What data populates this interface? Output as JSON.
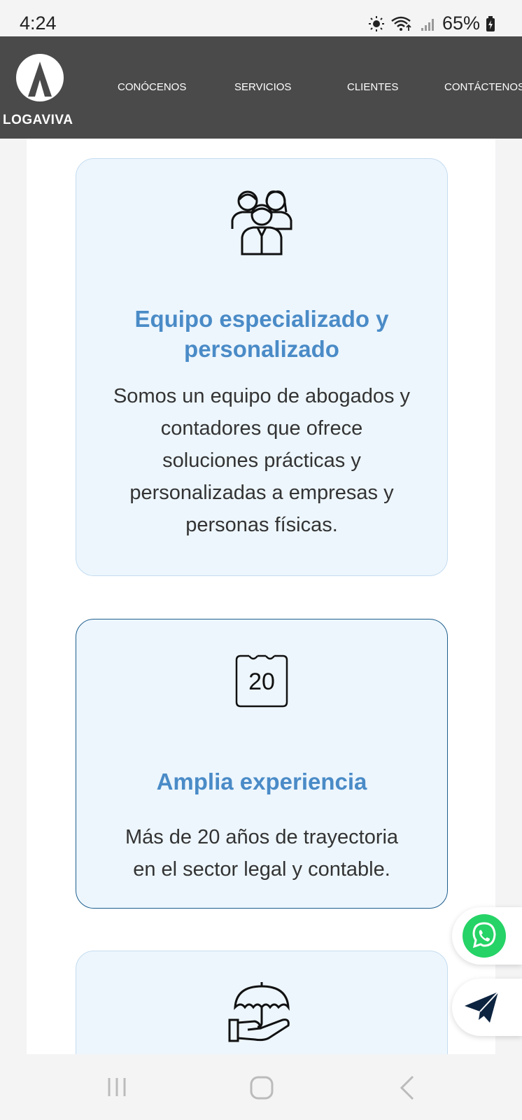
{
  "status": {
    "time": "4:24",
    "battery": "65%"
  },
  "brand": {
    "logo_text": "LOGAVIVA"
  },
  "nav": {
    "items": [
      "CONÓCENOS",
      "SERVICIOS",
      "CLIENTES",
      "CONTÁCTENOS"
    ]
  },
  "cards": [
    {
      "icon": "team-icon",
      "title_line1": "Equipo especializado y",
      "title_line2": "personalizado",
      "text_lines": [
        "Somos un equipo de abogados y",
        "contadores que ofrece",
        "soluciones prácticas y",
        "personalizadas a empresas y",
        "personas físicas."
      ]
    },
    {
      "icon": "calendar-icon",
      "icon_number": "20",
      "title": "Amplia experiencia",
      "text_lines": [
        "Más de 20 años de trayectoria",
        "en el sector legal y contable."
      ]
    },
    {
      "icon": "umbrella-hand-icon"
    }
  ],
  "floating": {
    "whatsapp_icon": "whatsapp-icon",
    "send_icon": "paper-plane-icon",
    "whatsapp_color": "#25d366",
    "send_color": "#0d2440"
  },
  "colors": {
    "header_bg": "#4a4a4a",
    "card_bg": "#edf6fd",
    "title_blue": "#4a8bc7"
  }
}
